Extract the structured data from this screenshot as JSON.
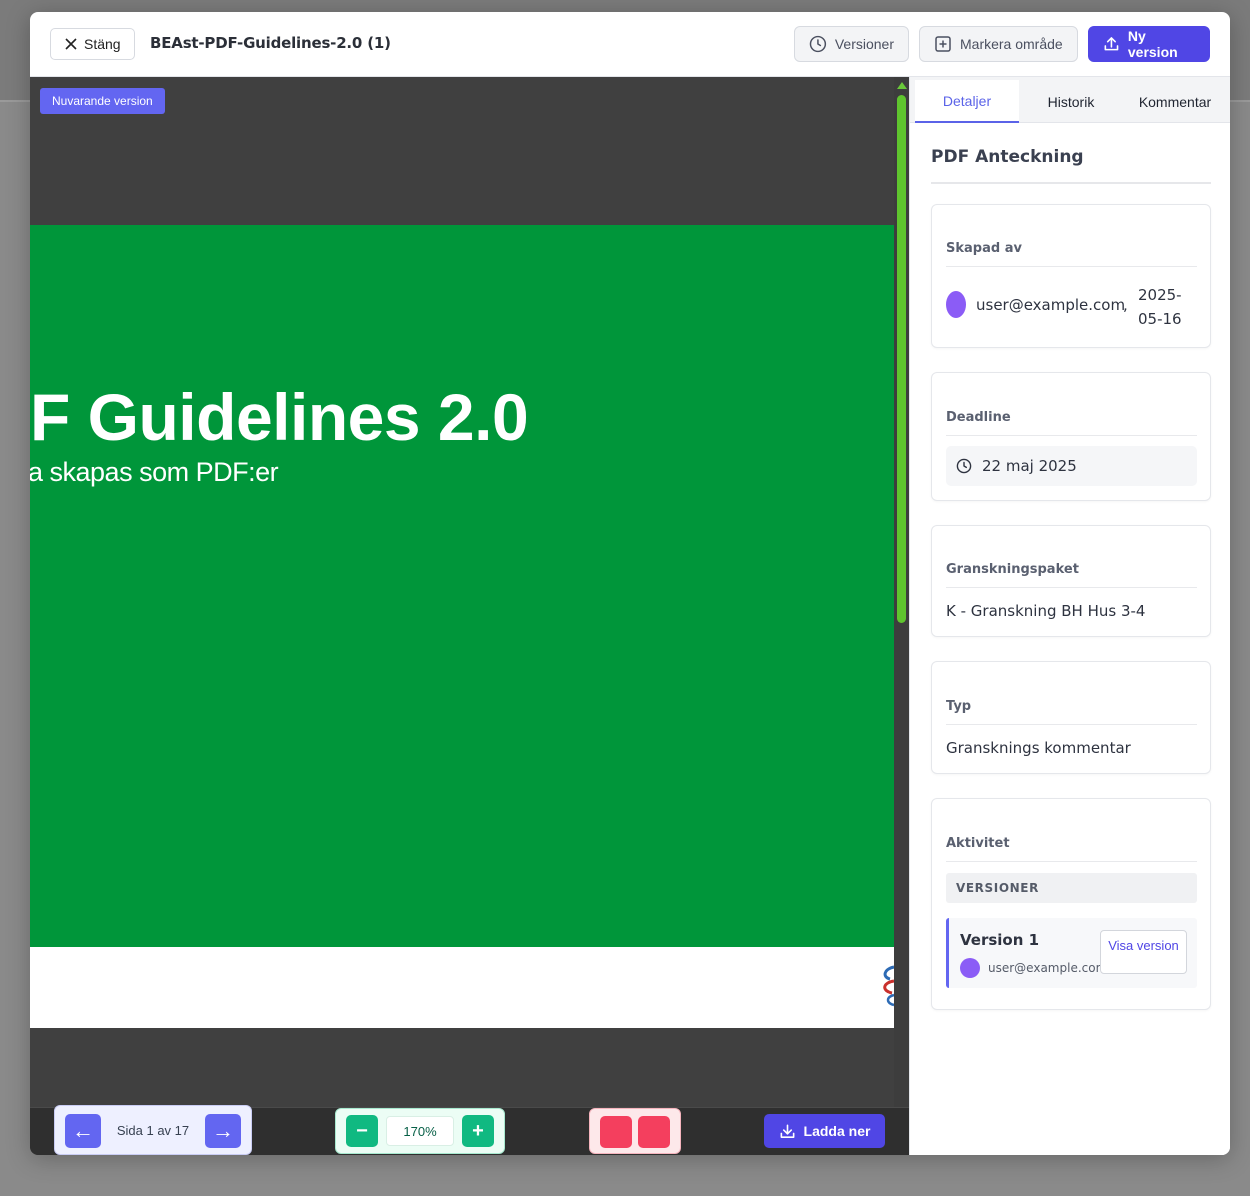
{
  "header": {
    "close_label": "Stäng",
    "doc_title": "BEAst-PDF-Guidelines-2.0 (1)",
    "versions_label": "Versioner",
    "mark_area_label": "Markera område",
    "new_version_label": "Ny version"
  },
  "viewer": {
    "badge": "Nuvarande version",
    "page_title": "F Guidelines 2.0",
    "page_subtitle": "a skapas som PDF:er"
  },
  "toolbar": {
    "prev_icon": "←",
    "next_icon": "→",
    "page_label": "Sida 1 av 17",
    "zoom_minus": "−",
    "zoom_plus": "+",
    "zoom_value": "170%",
    "download_label": "Ladda ner"
  },
  "sidebar": {
    "tabs": [
      {
        "label": "Detaljer",
        "active": true
      },
      {
        "label": "Historik",
        "active": false
      },
      {
        "label": "Kommentar",
        "active": false
      }
    ],
    "title": "PDF Anteckning",
    "created": {
      "label": "Skapad av",
      "user": "user@example.com",
      "separator": ",",
      "date": "2025-05-16"
    },
    "deadline": {
      "label": "Deadline",
      "value": "22 maj 2025"
    },
    "package": {
      "label": "Granskningspaket",
      "value": "K - Granskning BH Hus 3-4"
    },
    "type": {
      "label": "Typ",
      "value": "Gransknings kommentar"
    },
    "activity": {
      "label": "Aktivitet",
      "section": "VERSIONER",
      "versions": [
        {
          "name": "Version 1",
          "user": "user@example.com",
          "action": "Visa version"
        }
      ]
    }
  },
  "colors": {
    "accent": "#5046e5",
    "badge": "#6366f1",
    "page_green": "#00963a",
    "zoom_green": "#10b981",
    "red": "#f43f5e",
    "avatar": "#8b5cf6",
    "scroll_thumb": "#5fc52e"
  },
  "icons": [
    "close-icon",
    "clock-icon",
    "plus-square-icon",
    "upload-icon",
    "download-icon",
    "arrow-left-icon",
    "arrow-right-icon",
    "minus-icon",
    "plus-icon"
  ]
}
